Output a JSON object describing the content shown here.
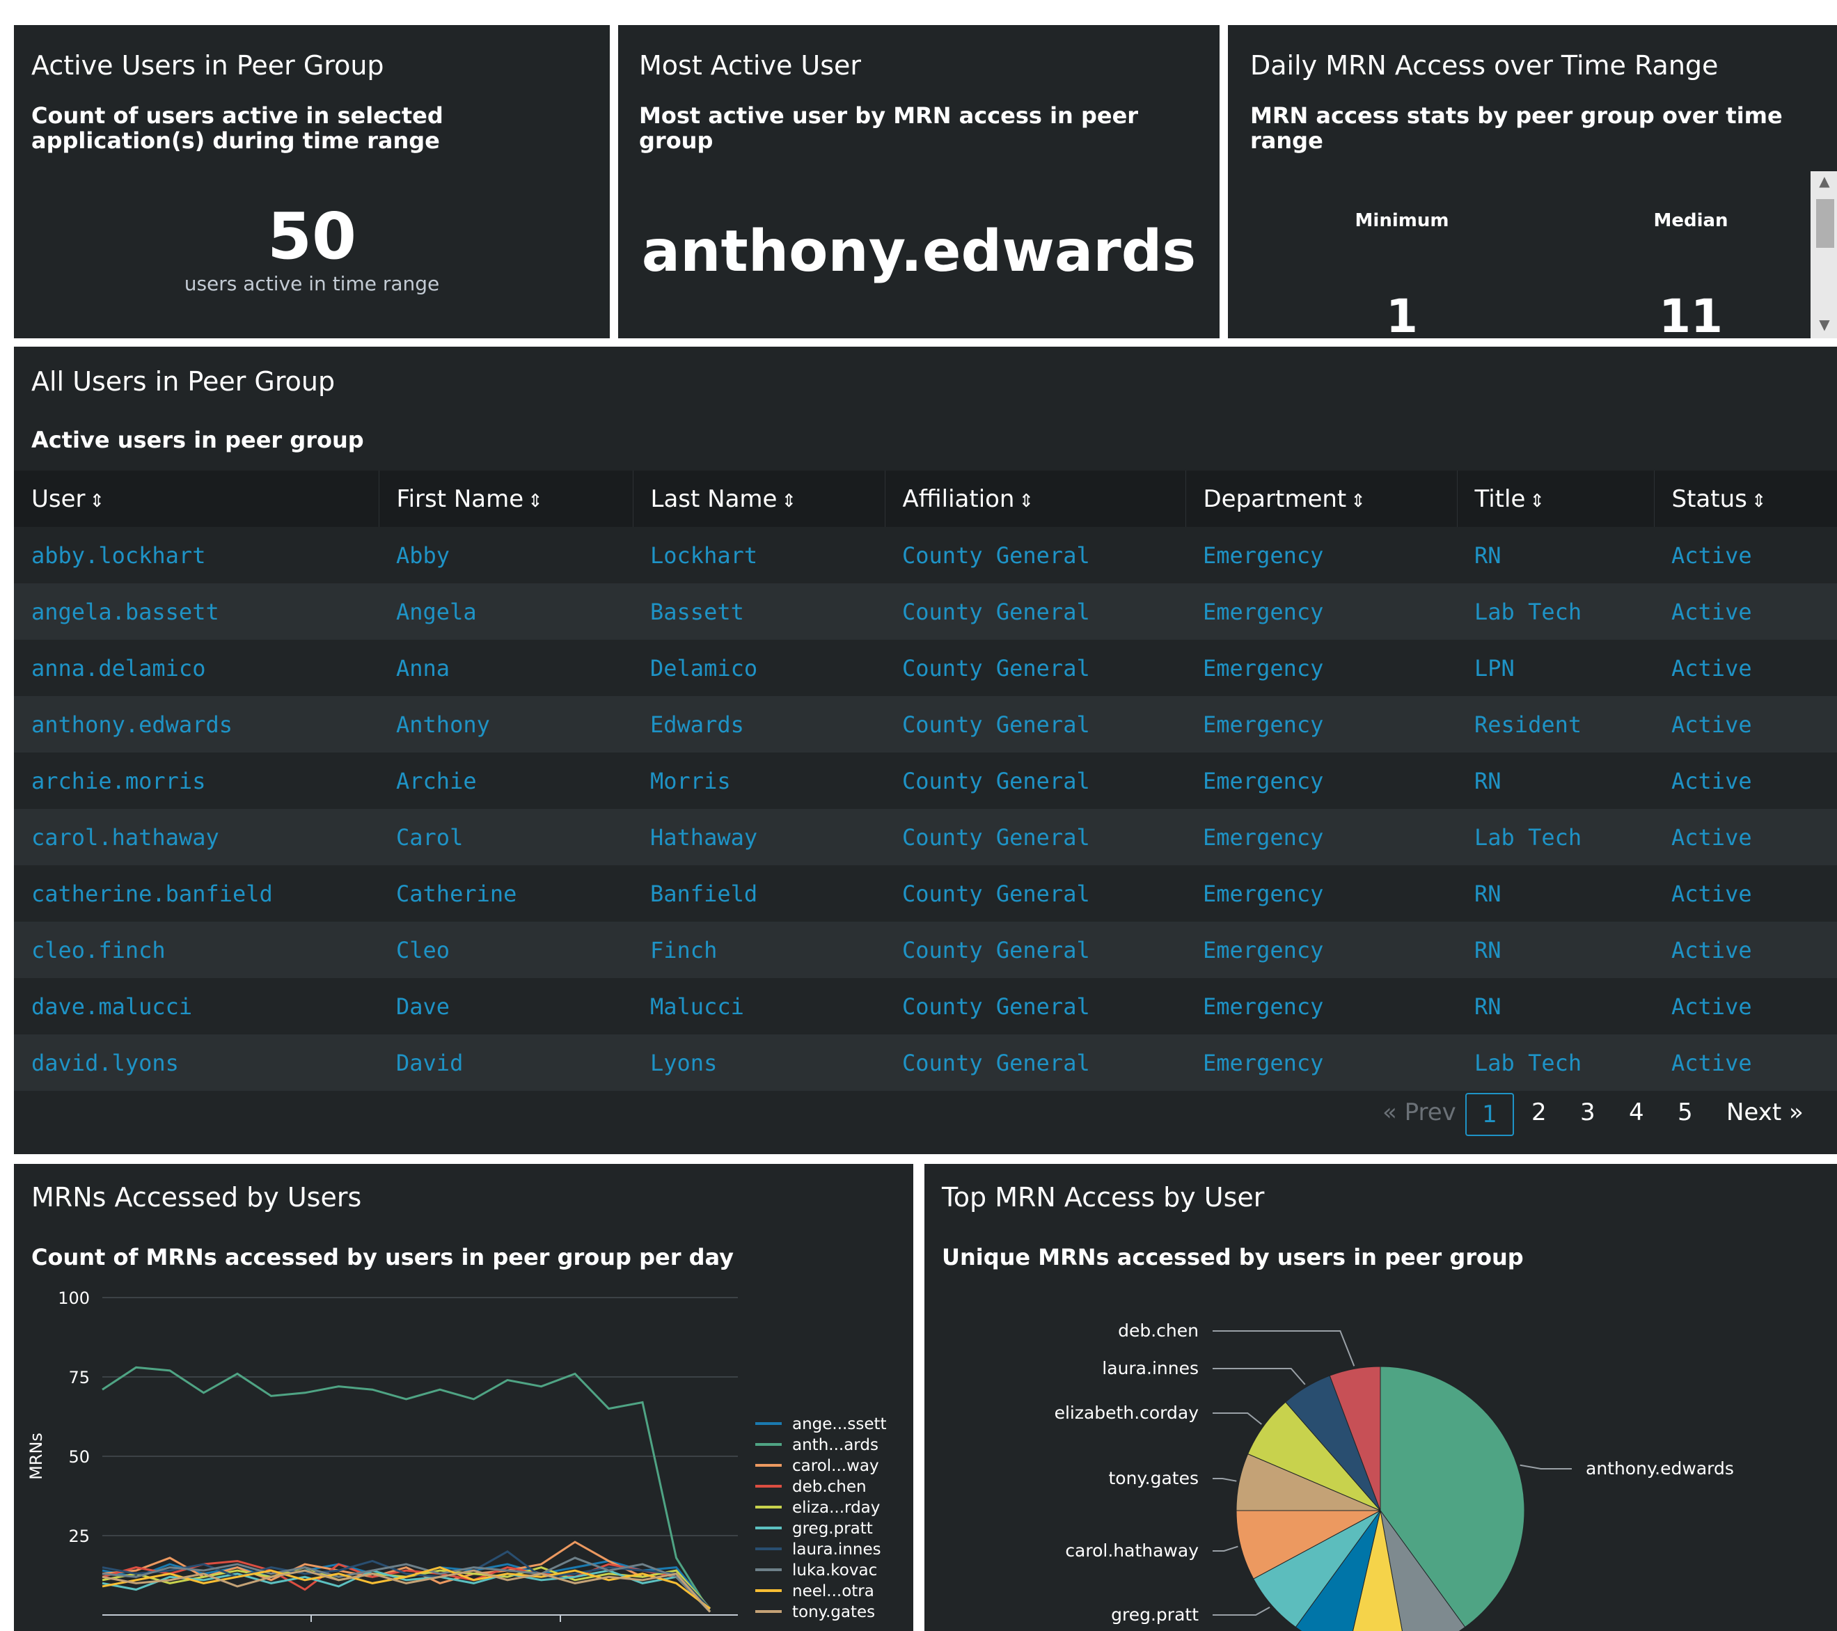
{
  "colors": {
    "panel_bg": "#212527",
    "table_header_bg": "#191c1e",
    "row_alt_bg": "#2b3033",
    "link": "#1e93c6"
  },
  "panels": {
    "active_users": {
      "title": "Active Users in Peer Group",
      "subtitle_line1": "Count of users active in selected",
      "subtitle_line2": "application(s) during time range",
      "value": "50",
      "caption": "users active in time range"
    },
    "most_active": {
      "title": "Most Active User",
      "subtitle_line1": "Most active user by MRN access in peer",
      "subtitle_line2": "group",
      "value": "anthony.edwards"
    },
    "daily_mrn": {
      "title": "Daily MRN Access over Time Range",
      "subtitle_line1": "MRN access stats by peer group over time",
      "subtitle_line2": "range",
      "stats": [
        {
          "label": "Minimum",
          "value": "1"
        },
        {
          "label": "Median",
          "value": "11"
        }
      ]
    }
  },
  "users_table": {
    "title": "All Users in Peer Group",
    "subtitle": "Active users in peer group",
    "sort_glyph": "⇕",
    "columns": [
      "User",
      "First Name",
      "Last Name",
      "Affiliation",
      "Department",
      "Title",
      "Status"
    ],
    "rows": [
      [
        "abby.lockhart",
        "Abby",
        "Lockhart",
        "County General",
        "Emergency",
        "RN",
        "Active"
      ],
      [
        "angela.bassett",
        "Angela",
        "Bassett",
        "County General",
        "Emergency",
        "Lab Tech",
        "Active"
      ],
      [
        "anna.delamico",
        "Anna",
        "Delamico",
        "County General",
        "Emergency",
        "LPN",
        "Active"
      ],
      [
        "anthony.edwards",
        "Anthony",
        "Edwards",
        "County General",
        "Emergency",
        "Resident",
        "Active"
      ],
      [
        "archie.morris",
        "Archie",
        "Morris",
        "County General",
        "Emergency",
        "RN",
        "Active"
      ],
      [
        "carol.hathaway",
        "Carol",
        "Hathaway",
        "County General",
        "Emergency",
        "Lab Tech",
        "Active"
      ],
      [
        "catherine.banfield",
        "Catherine",
        "Banfield",
        "County General",
        "Emergency",
        "RN",
        "Active"
      ],
      [
        "cleo.finch",
        "Cleo",
        "Finch",
        "County General",
        "Emergency",
        "RN",
        "Active"
      ],
      [
        "dave.malucci",
        "Dave",
        "Malucci",
        "County General",
        "Emergency",
        "RN",
        "Active"
      ],
      [
        "david.lyons",
        "David",
        "Lyons",
        "County General",
        "Emergency",
        "Lab Tech",
        "Active"
      ]
    ],
    "pagination": {
      "prev": "« Prev",
      "pages": [
        "1",
        "2",
        "3",
        "4",
        "5"
      ],
      "current": "1",
      "next": "Next »"
    }
  },
  "line_panel": {
    "title": "MRNs Accessed by Users",
    "subtitle": "Count of MRNs accessed by users in peer group per day"
  },
  "pie_panel": {
    "title": "Top MRN Access by User",
    "subtitle": "Unique MRNs accessed by users in peer group"
  },
  "chart_data": [
    {
      "type": "line",
      "ylabel": "MRNs",
      "ylim": [
        0,
        100
      ],
      "yticks": [
        25,
        50,
        75,
        100
      ],
      "grid": true,
      "legend_position": "right",
      "x_count": 19,
      "series": [
        {
          "name": "ange...ssett",
          "color": "#1a7ab0",
          "values": [
            14,
            12,
            16,
            13,
            15,
            12,
            14,
            16,
            13,
            12,
            15,
            14,
            16,
            13,
            15,
            17,
            14,
            15,
            2
          ]
        },
        {
          "name": "anth...ards",
          "color": "#4fa484",
          "values": [
            71,
            78,
            77,
            70,
            76,
            69,
            70,
            72,
            71,
            68,
            71,
            68,
            74,
            72,
            76,
            65,
            67,
            18,
            1
          ]
        },
        {
          "name": "carol...way",
          "color": "#ec9960",
          "values": [
            13,
            14,
            18,
            12,
            15,
            11,
            16,
            14,
            12,
            15,
            10,
            13,
            14,
            16,
            23,
            17,
            12,
            14,
            2
          ]
        },
        {
          "name": "deb.chen",
          "color": "#dc4e41",
          "values": [
            12,
            15,
            13,
            16,
            17,
            14,
            8,
            16,
            12,
            14,
            13,
            11,
            15,
            13,
            12,
            16,
            14,
            12,
            1
          ]
        },
        {
          "name": "eliza...rday",
          "color": "#c8d24d",
          "values": [
            11,
            13,
            10,
            12,
            14,
            12,
            15,
            11,
            13,
            12,
            14,
            13,
            12,
            15,
            11,
            13,
            12,
            14,
            2
          ]
        },
        {
          "name": "greg.pratt",
          "color": "#5cc0c0",
          "values": [
            10,
            8,
            12,
            11,
            13,
            10,
            12,
            9,
            14,
            11,
            12,
            10,
            13,
            11,
            12,
            14,
            10,
            12,
            1
          ]
        },
        {
          "name": "laura.innes",
          "color": "#294e70",
          "values": [
            15,
            13,
            14,
            16,
            12,
            15,
            13,
            14,
            17,
            13,
            12,
            14,
            20,
            12,
            13,
            15,
            14,
            13,
            2
          ]
        },
        {
          "name": "luka.kovac",
          "color": "#6e8089",
          "values": [
            13,
            12,
            15,
            14,
            16,
            13,
            15,
            12,
            14,
            16,
            13,
            15,
            14,
            13,
            18,
            14,
            16,
            12,
            1
          ]
        },
        {
          "name": "neel...otra",
          "color": "#f8be34",
          "values": [
            9,
            11,
            13,
            10,
            12,
            14,
            11,
            13,
            10,
            12,
            15,
            11,
            13,
            12,
            14,
            11,
            13,
            10,
            2
          ]
        },
        {
          "name": "tony.gates",
          "color": "#c4a276",
          "values": [
            12,
            10,
            11,
            13,
            9,
            12,
            14,
            11,
            13,
            10,
            12,
            14,
            11,
            13,
            10,
            12,
            11,
            13,
            1
          ]
        }
      ]
    },
    {
      "type": "pie",
      "label_count_note": "",
      "slices": [
        {
          "label": "anthony.edwards",
          "value": 28,
          "color": "#4fa484"
        },
        {
          "label": "",
          "value": 5,
          "color": "#7e8a8f"
        },
        {
          "label": "",
          "value": 4.5,
          "color": "#f5d34a"
        },
        {
          "label": "",
          "value": 4.5,
          "color": "#0075a8"
        },
        {
          "label": "greg.pratt",
          "value": 5,
          "color": "#5cbdbd"
        },
        {
          "label": "carol.hathaway",
          "value": 5.5,
          "color": "#ec9960"
        },
        {
          "label": "tony.gates",
          "value": 4.5,
          "color": "#c4a276"
        },
        {
          "label": "elizabeth.corday",
          "value": 5,
          "color": "#c8d24d"
        },
        {
          "label": "laura.innes",
          "value": 4,
          "color": "#294e70"
        },
        {
          "label": "deb.chen",
          "value": 4,
          "color": "#c75056"
        }
      ]
    }
  ]
}
